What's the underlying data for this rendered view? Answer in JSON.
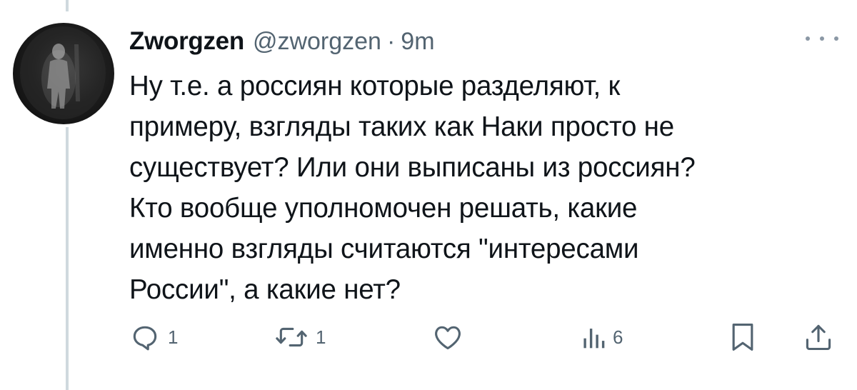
{
  "tweet": {
    "display_name": "Zworgzen",
    "handle": "@zworgzen",
    "separator": "·",
    "time": "9m",
    "text": "Ну т.е. а россиян которые разделяют, к\nпримеру, взгляды таких как Наки просто не\nсуществует? Или они выписаны из россиян?\nКто вообще уполномочен решать, какие\nименно взгляды считаются \"интересами\nРоссии\", а какие нет?"
  },
  "actions": {
    "reply_count": "1",
    "retweet_count": "1",
    "like_count": "",
    "views_count": "6"
  },
  "icons": {
    "reply": "reply-icon",
    "retweet": "retweet-icon",
    "like": "heart-icon",
    "views": "views-icon",
    "bookmark": "bookmark-icon",
    "share": "share-icon",
    "more": "more-icon"
  },
  "colors": {
    "text": "#0f1419",
    "secondary": "#536471",
    "thread_line": "#cfd9de"
  }
}
